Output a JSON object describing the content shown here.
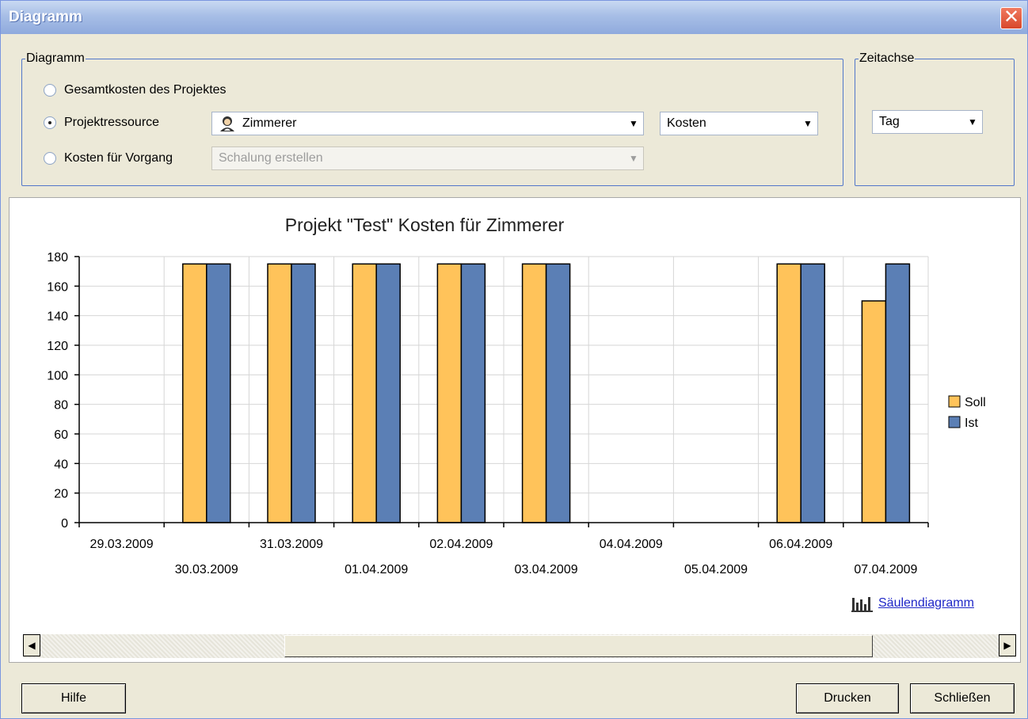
{
  "window": {
    "title": "Diagramm",
    "close_glyph": "✕"
  },
  "diagram_group": {
    "legend": "Diagramm",
    "options": [
      {
        "label": "Gesamtkosten des Projektes",
        "checked": false
      },
      {
        "label": "Projektressource",
        "checked": true
      },
      {
        "label": "Kosten für Vorgang",
        "checked": false
      }
    ],
    "resource_select": {
      "value": "Zimmerer",
      "icon": "person-icon"
    },
    "metric_select": {
      "value": "Kosten"
    },
    "task_select": {
      "value": "Schalung erstellen",
      "disabled": true
    }
  },
  "time_group": {
    "legend": "Zeitachse",
    "unit_select": {
      "value": "Tag"
    }
  },
  "chart_link": {
    "label": "Säulendiagramm",
    "icon": "column-chart-icon"
  },
  "buttons": {
    "help": "Hilfe",
    "print": "Drucken",
    "close": "Schließen"
  },
  "colors": {
    "soll": "#FFC35A",
    "ist": "#5B7FB5",
    "title_bar": "#8FAADD",
    "group_border": "#5277C9"
  },
  "chart_data": {
    "type": "bar",
    "title": "Projekt \"Test\" Kosten für Zimmerer",
    "categories": [
      "29.03.2009",
      "30.03.2009",
      "31.03.2009",
      "01.04.2009",
      "02.04.2009",
      "03.04.2009",
      "04.04.2009",
      "05.04.2009",
      "06.04.2009",
      "07.04.2009"
    ],
    "series": [
      {
        "name": "Soll",
        "values": [
          0,
          175,
          175,
          175,
          175,
          175,
          0,
          0,
          175,
          150
        ]
      },
      {
        "name": "Ist",
        "values": [
          0,
          175,
          175,
          175,
          175,
          175,
          0,
          0,
          175,
          175
        ]
      }
    ],
    "ylim": [
      0,
      180
    ],
    "yticks": [
      0,
      20,
      40,
      60,
      80,
      100,
      120,
      140,
      160,
      180
    ],
    "grid": true,
    "legend_position": "right"
  }
}
